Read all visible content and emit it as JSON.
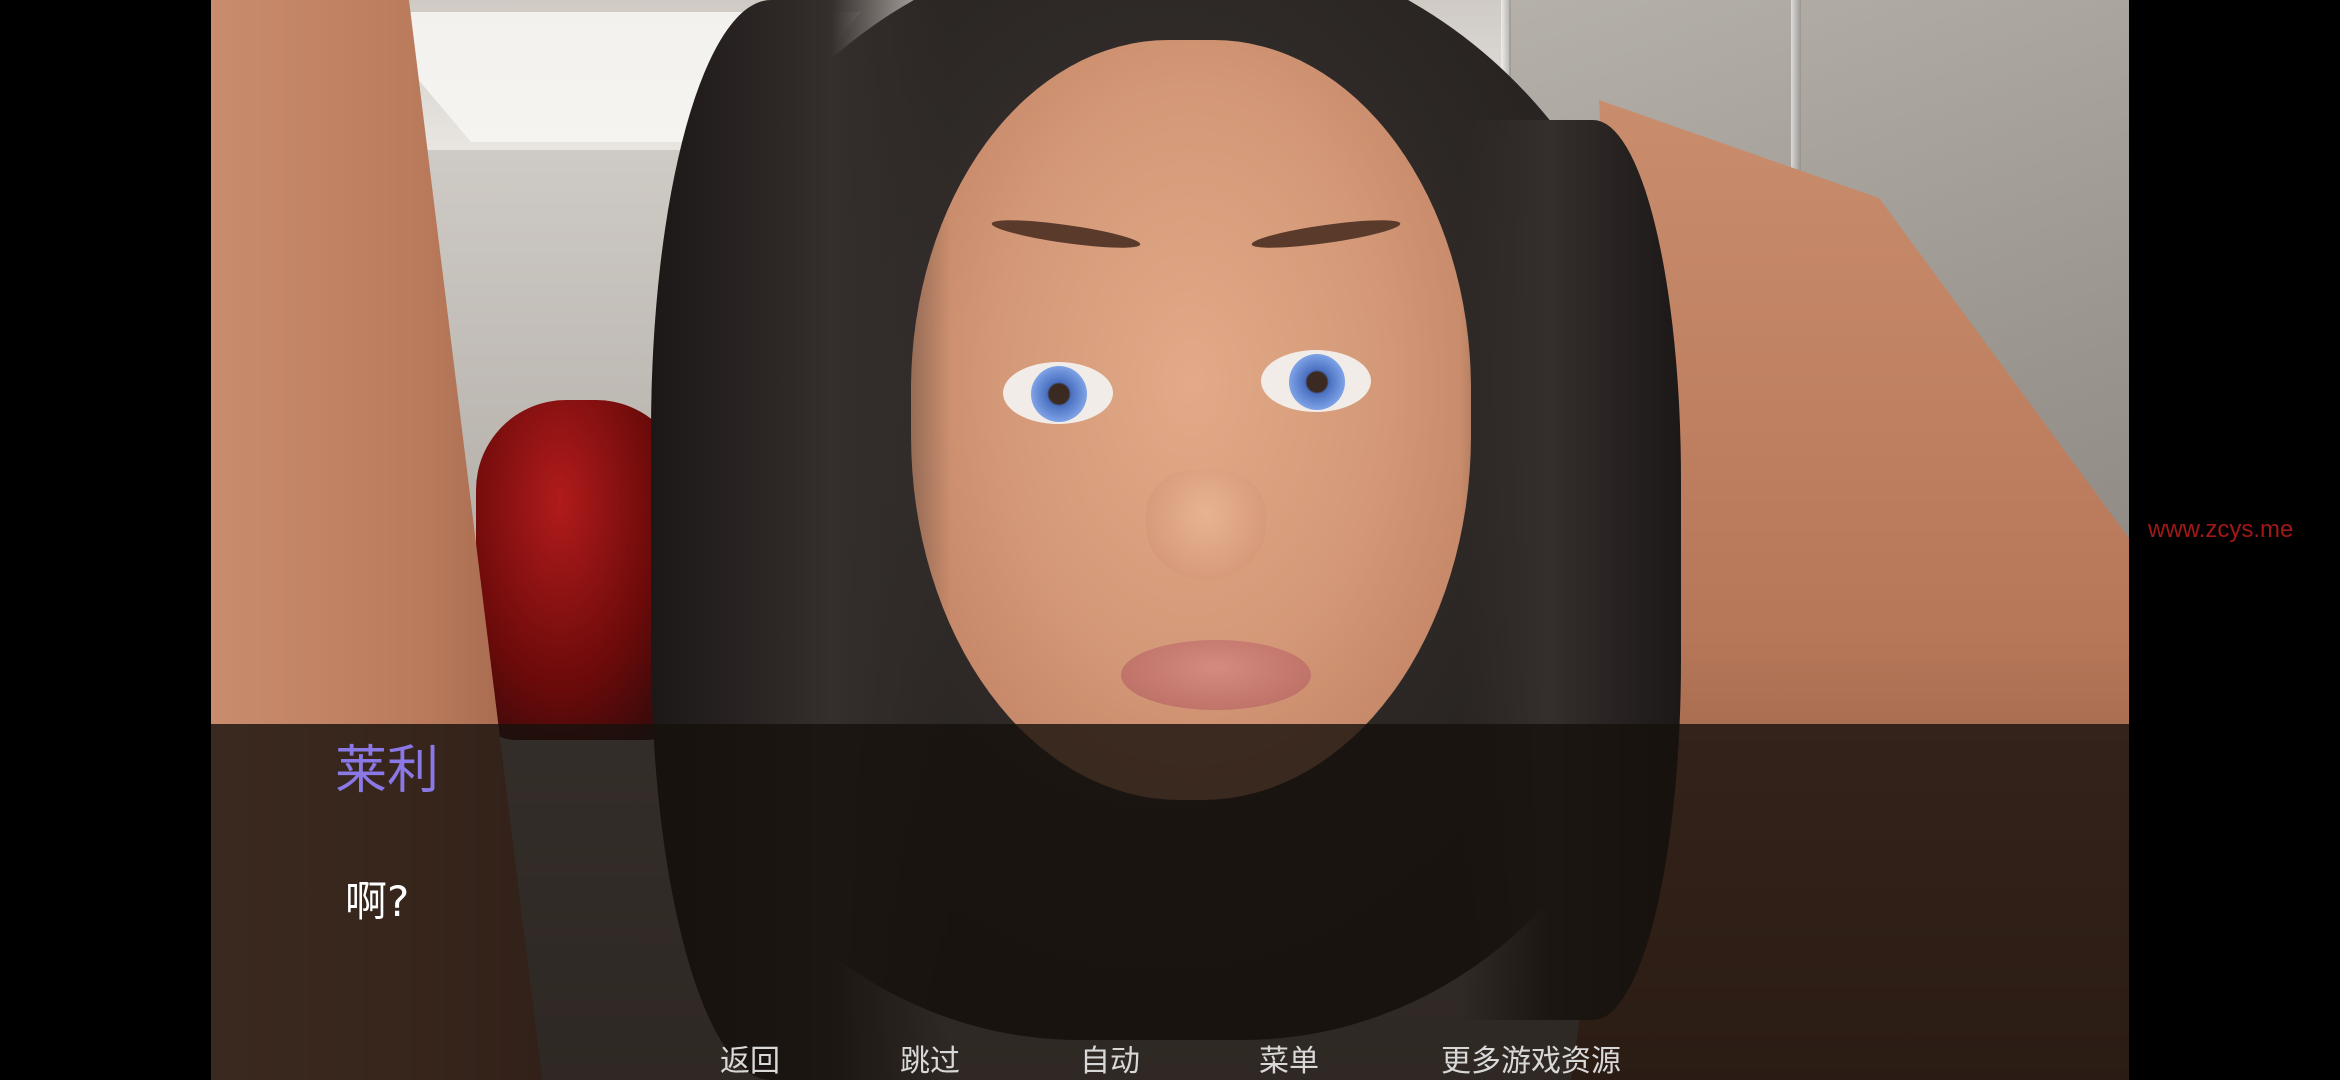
{
  "dialogue": {
    "speaker": "莱利",
    "text": "啊?",
    "speaker_color": "#8a78e6"
  },
  "quick_menu": {
    "back": "返回",
    "skip": "跳过",
    "auto": "自动",
    "menu": "菜单",
    "more_resources": "更多游戏资源"
  },
  "watermark": {
    "text": "www.zcys.me",
    "color": "#a01818"
  }
}
